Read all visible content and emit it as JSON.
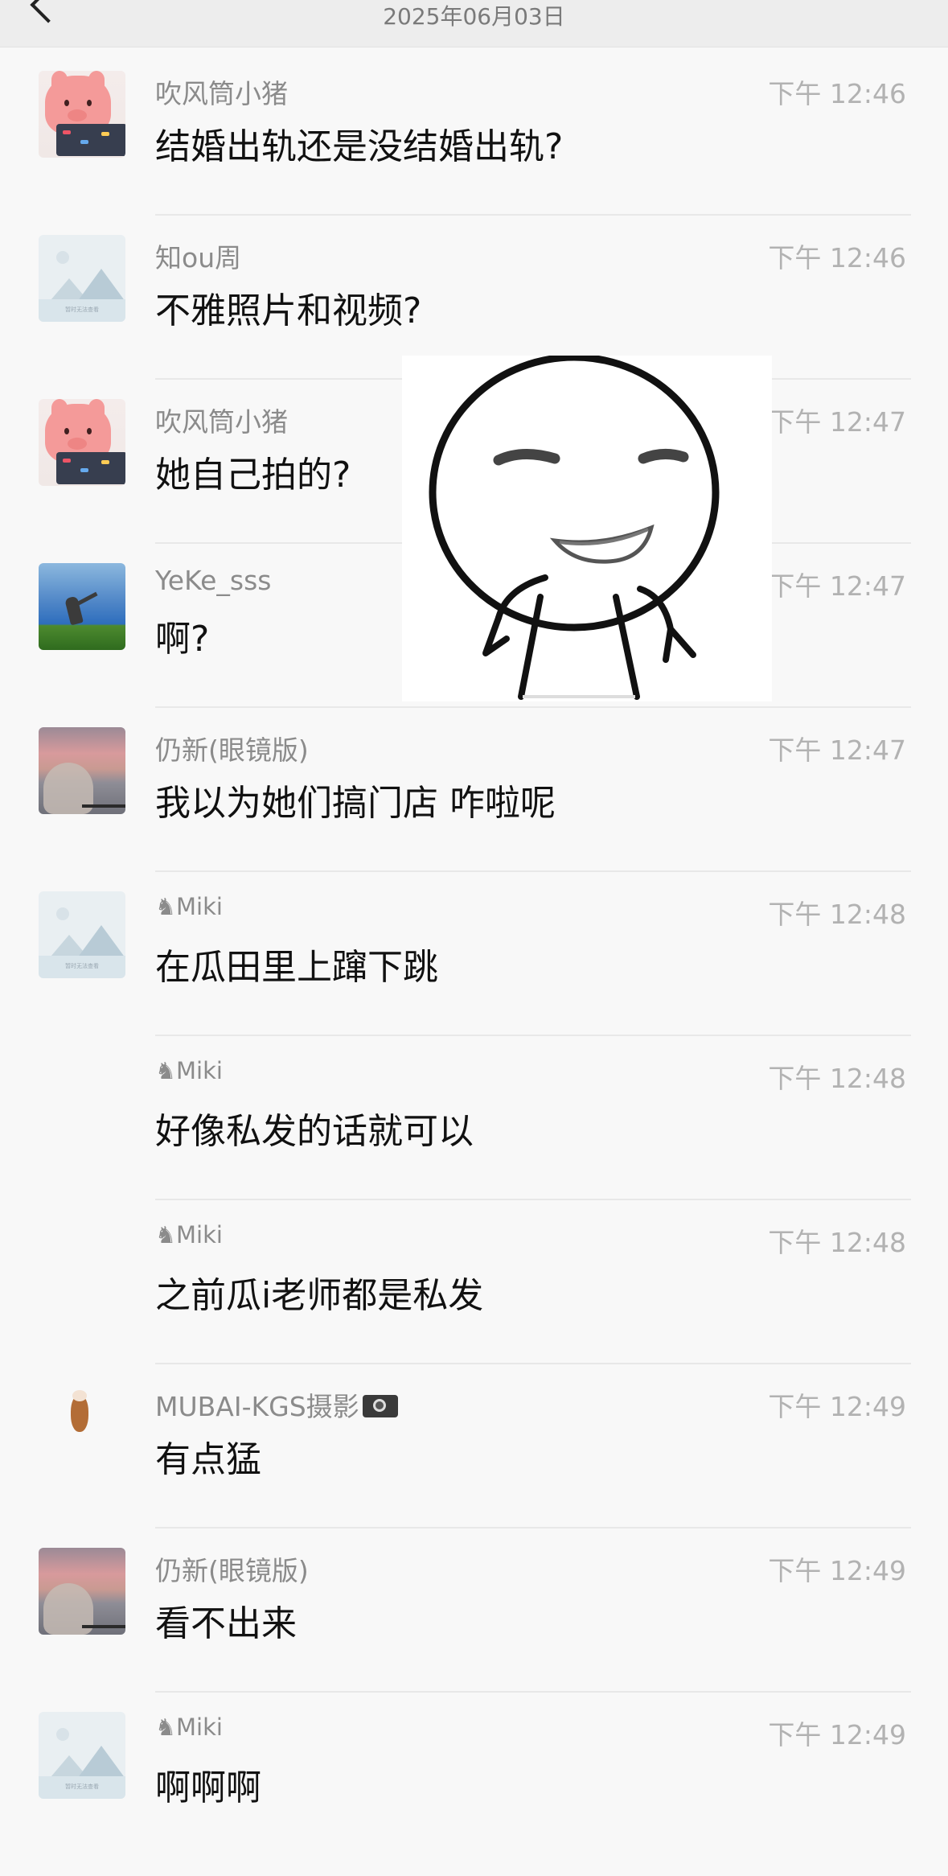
{
  "header": {
    "date": "2025年06月03日"
  },
  "messages": [
    {
      "avatar": "pink-pig-avatar",
      "nickname": "吹风筒小猪",
      "time": "下午 12:46",
      "text": "结婚出轨还是没结婚出轨?"
    },
    {
      "avatar": "placeholder-avatar",
      "nickname": "知ou周",
      "time": "下午 12:46",
      "text": "不雅照片和视频?"
    },
    {
      "avatar": "pink-pig-avatar",
      "nickname": "吹风筒小猪",
      "time": "下午 12:47",
      "text": "她自己拍的?"
    },
    {
      "avatar": "sky-avatar",
      "nickname": "YeKe_sss",
      "time": "下午 12:47",
      "text": "啊?"
    },
    {
      "avatar": "sunset-avatar",
      "nickname": "仍新(眼镜版)",
      "time": "下午 12:47",
      "text": "我以为她们搞门店 咋啦呢"
    },
    {
      "avatar": "placeholder-avatar",
      "nickname": "♞Miki",
      "time": "下午 12:48",
      "text": "在瓜田里上蹿下跳"
    },
    {
      "avatar": "none",
      "nickname": "♞Miki",
      "time": "下午 12:48",
      "text": "好像私发的话就可以"
    },
    {
      "avatar": "none",
      "nickname": "♞Miki",
      "time": "下午 12:48",
      "text": "之前瓜i老师都是私发"
    },
    {
      "avatar": "mini-dog-avatar",
      "nickname": "MUBAI-KGS摄影",
      "time": "下午 12:49",
      "text": "有点猛"
    },
    {
      "avatar": "sunset-avatar",
      "nickname": "仍新(眼镜版)",
      "time": "下午 12:49",
      "text": "看不出来"
    },
    {
      "avatar": "placeholder-avatar",
      "nickname": "♞Miki",
      "time": "下午 12:49",
      "text": "啊啊啊"
    }
  ],
  "placeholder_caption": "暂时无法查看",
  "sticker": {
    "icon": "smirking-face-sticker"
  }
}
